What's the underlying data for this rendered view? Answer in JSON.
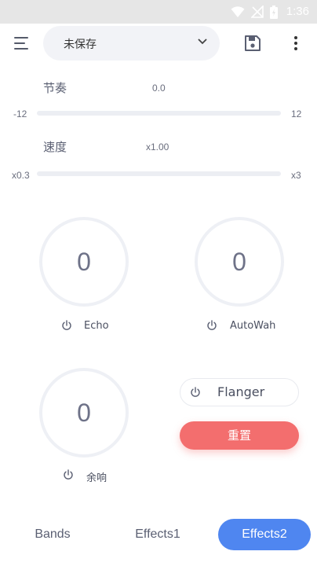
{
  "status_bar": {
    "time": "1:36",
    "icons": [
      "wifi-icon",
      "no-signal-icon",
      "battery-icon"
    ]
  },
  "header": {
    "preset_label": "未保存",
    "icons": [
      "menu-icon",
      "chevron-down-icon",
      "save-icon",
      "more-vert-icon"
    ]
  },
  "sliders": [
    {
      "label": "节奏",
      "value": "0.0",
      "min": "-12",
      "max": "12"
    },
    {
      "label": "速度",
      "value": "x1.00",
      "min": "x0.3",
      "max": "x3"
    }
  ],
  "effects": [
    {
      "value": "0",
      "label": "Echo"
    },
    {
      "value": "0",
      "label": "AutoWah"
    },
    {
      "value": "0",
      "label": "余响"
    }
  ],
  "flanger": {
    "label": "Flanger"
  },
  "reset_label": "重置",
  "tabs": [
    {
      "label": "Bands",
      "active": false
    },
    {
      "label": "Effects1",
      "active": false
    },
    {
      "label": "Effects2",
      "active": true
    }
  ],
  "colors": {
    "accent": "#4f86f0",
    "reset": "#f36e6e",
    "track": "#eceef3"
  }
}
